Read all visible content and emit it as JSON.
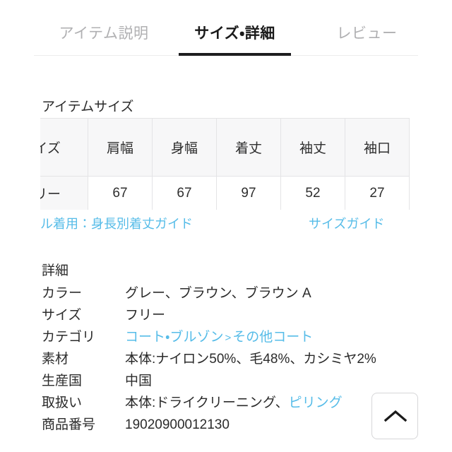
{
  "tabs": [
    {
      "label": "アイテム説明",
      "active": false
    },
    {
      "label": "サイズ・詳細",
      "active": true
    },
    {
      "label": "レビュー",
      "active": false
    }
  ],
  "size_section": {
    "heading": "アイテムサイズ",
    "columns": [
      "イズ",
      "肩幅",
      "身幅",
      "着丈",
      "袖丈",
      "袖口"
    ],
    "rows": [
      [
        "リー",
        "67",
        "67",
        "97",
        "52",
        "27"
      ]
    ],
    "links": {
      "model_guide": "ル着用：身長別着丈ガイド",
      "size_guide": "サイズガイド"
    }
  },
  "detail_section": {
    "heading": "詳細",
    "rows": [
      {
        "label": "カラー",
        "value": "グレー、ブラウン、ブラウン A"
      },
      {
        "label": "サイズ",
        "value": "フリー"
      },
      {
        "label": "カテゴリ",
        "value_parts": {
          "first": "コート・ブルゾン",
          "separator": ">",
          "second": "その他コート"
        }
      },
      {
        "label": "素材",
        "value": "本体:ナイロン50%、毛48%、カシミヤ2%"
      },
      {
        "label": "生産国",
        "value": "中国"
      },
      {
        "label": "取扱い",
        "value_parts": {
          "text": "本体:ドライクリーニング、",
          "link": "ピリング"
        }
      },
      {
        "label": "商品番号",
        "value": "19020900012130"
      }
    ]
  },
  "scroll_top_button": {
    "icon": "chevron-up-icon"
  },
  "colors": {
    "link": "#56bce8",
    "active_tab": "#1a1a1a",
    "inactive_tab": "#b0b0b2",
    "table_header_bg": "#f7f7f8",
    "border": "#e4e4e6"
  }
}
